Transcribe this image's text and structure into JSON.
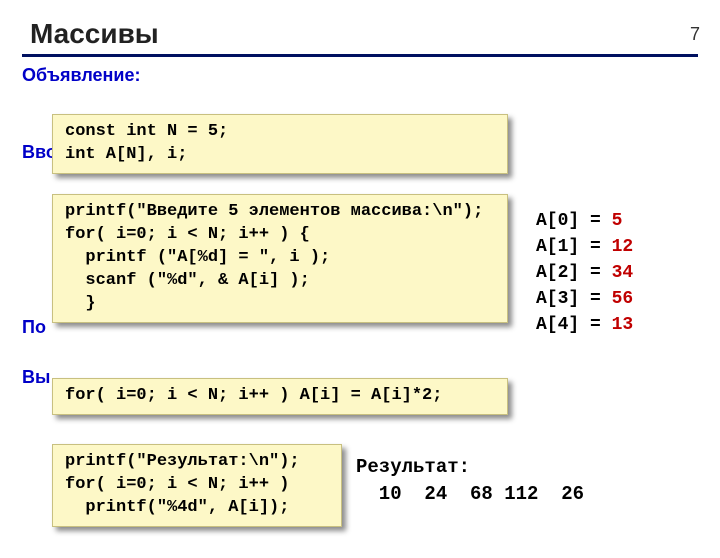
{
  "page_number": "7",
  "title": "Массивы",
  "sections": {
    "declaration": "Объявление:",
    "input": "Ввод с клавиатуры:",
    "process": "По",
    "output": "Вы"
  },
  "code": {
    "decl": "const int N = 5;\nint A[N], i;",
    "input": "printf(\"Введите 5 элементов массива:\\n\");\nfor( i=0; i < N; i++ ) {\n  printf (\"A[%d] = \", i );\n  scanf (\"%d\", & A[i] );\n  }",
    "process": "for( i=0; i < N; i++ ) A[i] = A[i]*2;",
    "output": "printf(\"Результат:\\n\");\nfor( i=0; i < N; i++ )\n  printf(\"%4d\", A[i]);"
  },
  "sample": {
    "rows": [
      {
        "k": "A[0] =",
        "v": "5"
      },
      {
        "k": "A[1] =",
        "v": "12"
      },
      {
        "k": "A[2] =",
        "v": "34"
      },
      {
        "k": "A[3] =",
        "v": "56"
      },
      {
        "k": "A[4] =",
        "v": "13"
      }
    ]
  },
  "result": {
    "label": "Результат:",
    "values": "  10  24  68 112  26"
  }
}
